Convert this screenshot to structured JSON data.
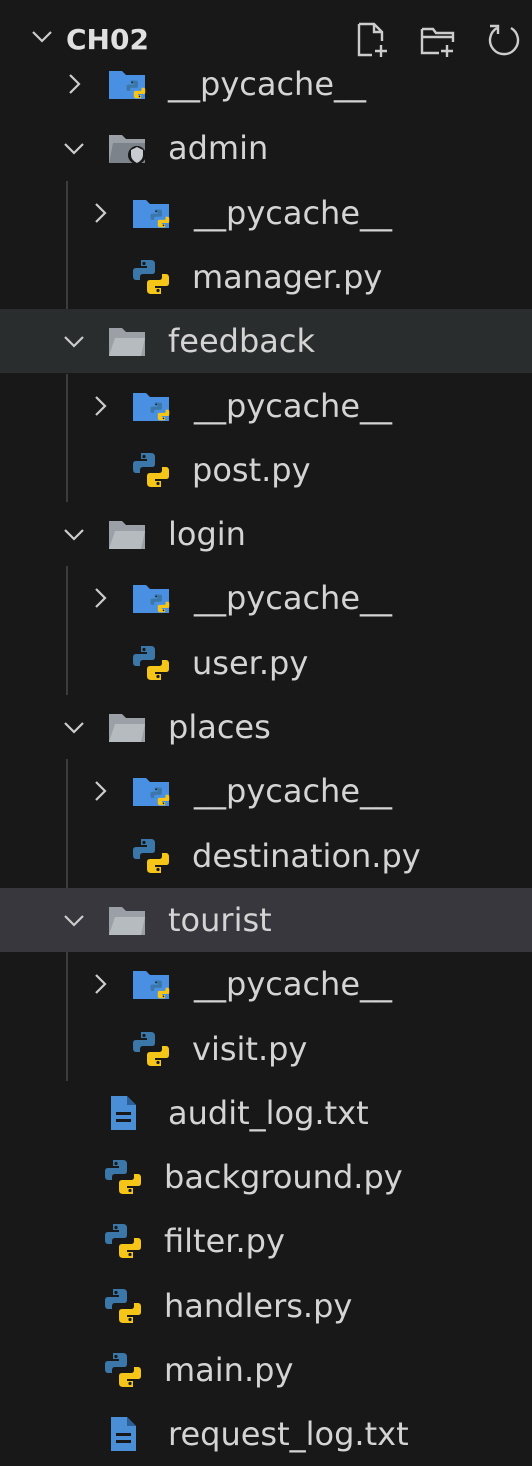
{
  "explorer": {
    "root_title": "CH02",
    "actions": [
      {
        "name": "new-file-button",
        "icon": "new-file-icon"
      },
      {
        "name": "new-folder-button",
        "icon": "new-folder-icon"
      },
      {
        "name": "refresh-button",
        "icon": "refresh-icon"
      }
    ],
    "tree": [
      {
        "label": "__pycache__",
        "kind": "pycache",
        "depth": 0,
        "chevron": "right"
      },
      {
        "label": "admin",
        "kind": "admin-folder",
        "depth": 0,
        "chevron": "down"
      },
      {
        "label": "__pycache__",
        "kind": "pycache",
        "depth": 1,
        "chevron": "right"
      },
      {
        "label": "manager.py",
        "kind": "python",
        "depth": 1,
        "chevron": "none"
      },
      {
        "label": "feedback",
        "kind": "folder",
        "depth": 0,
        "chevron": "down",
        "state": "hover"
      },
      {
        "label": "__pycache__",
        "kind": "pycache",
        "depth": 1,
        "chevron": "right"
      },
      {
        "label": "post.py",
        "kind": "python",
        "depth": 1,
        "chevron": "none"
      },
      {
        "label": "login",
        "kind": "folder",
        "depth": 0,
        "chevron": "down"
      },
      {
        "label": "__pycache__",
        "kind": "pycache",
        "depth": 1,
        "chevron": "right"
      },
      {
        "label": "user.py",
        "kind": "python",
        "depth": 1,
        "chevron": "none"
      },
      {
        "label": "places",
        "kind": "folder",
        "depth": 0,
        "chevron": "down"
      },
      {
        "label": "__pycache__",
        "kind": "pycache",
        "depth": 1,
        "chevron": "right"
      },
      {
        "label": "destination.py",
        "kind": "python",
        "depth": 1,
        "chevron": "none"
      },
      {
        "label": "tourist",
        "kind": "folder",
        "depth": 0,
        "chevron": "down",
        "state": "active"
      },
      {
        "label": "__pycache__",
        "kind": "pycache",
        "depth": 1,
        "chevron": "right"
      },
      {
        "label": "visit.py",
        "kind": "python",
        "depth": 1,
        "chevron": "none"
      },
      {
        "label": "audit_log.txt",
        "kind": "text",
        "depth": 0,
        "chevron": "none"
      },
      {
        "label": "background.py",
        "kind": "python",
        "depth": 0,
        "chevron": "none"
      },
      {
        "label": "filter.py",
        "kind": "python",
        "depth": 0,
        "chevron": "none"
      },
      {
        "label": "handlers.py",
        "kind": "python",
        "depth": 0,
        "chevron": "none"
      },
      {
        "label": "main.py",
        "kind": "python",
        "depth": 0,
        "chevron": "none"
      },
      {
        "label": "request_log.txt",
        "kind": "text",
        "depth": 0,
        "chevron": "none"
      }
    ]
  },
  "colors": {
    "background": "#181818",
    "hover_row": "#2a2d2e",
    "active_row": "#37373d",
    "text": "#d4d4d4",
    "python_blue": "#3b77a8",
    "python_yellow": "#f5c518",
    "pycache_folder": "#4a90e2",
    "folder_gray": "#9aa0a6",
    "text_file_blue": "#4a8fd6"
  }
}
